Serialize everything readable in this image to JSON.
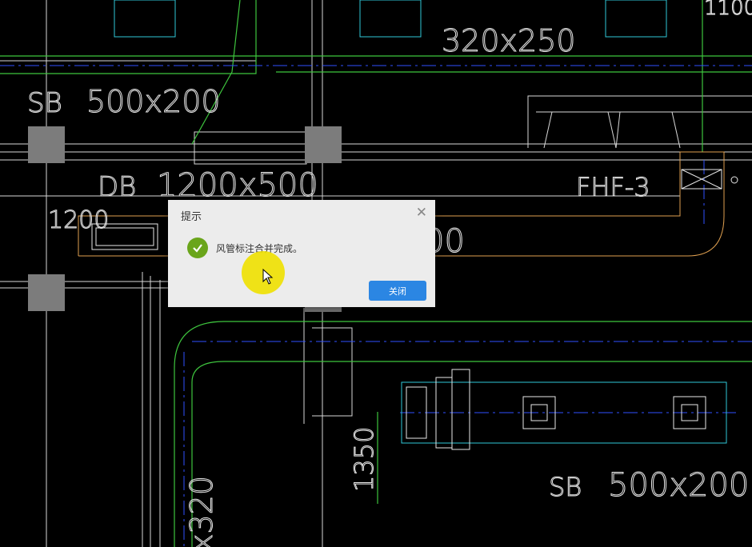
{
  "cad": {
    "labels": {
      "duct_top": "320x250",
      "sb_top_prefix": "SB",
      "sb_top_size": "500x200",
      "db_prefix": "DB",
      "db_size": "1200x500",
      "dim_1200": "1200",
      "fhf": "FHF-3",
      "dim_1100": "1100",
      "dim_1350": "1350",
      "dim_x320": "x320",
      "hidden_partial": "00",
      "sb_bottom_prefix": "SB",
      "sb_bottom_size": "500x200"
    }
  },
  "dialog": {
    "title": "提示",
    "close_icon": "close-icon",
    "status_icon": "success-check-icon",
    "message": "风管标注合并完成。",
    "close_button": "关闭",
    "accent": "#2b86e3",
    "success": "#6aa51b"
  }
}
